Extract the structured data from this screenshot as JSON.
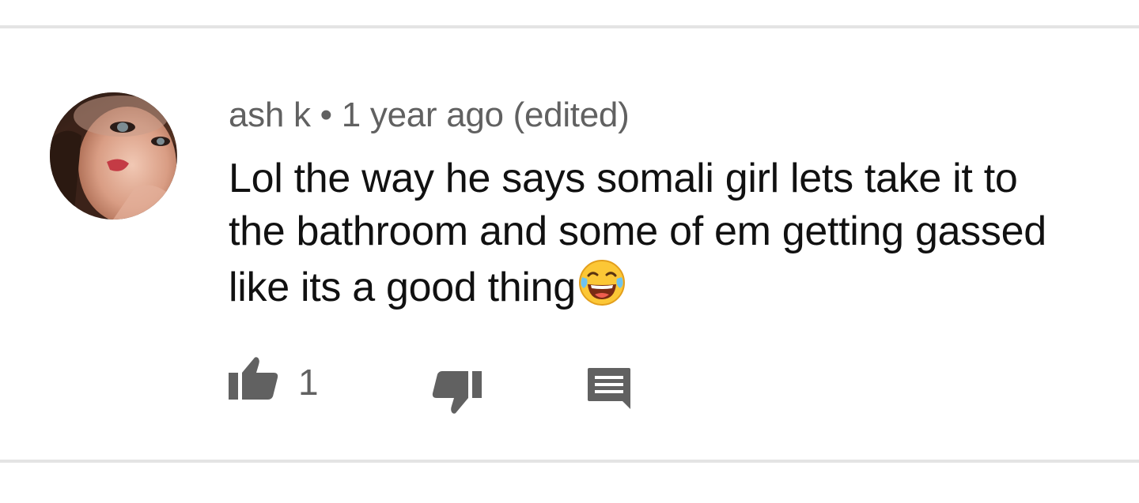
{
  "comment": {
    "author": "ash k",
    "separator": "•",
    "timestamp": "1 year ago (edited)",
    "text": "Lol the way he says somali girl lets take it to the bathroom and some of em getting gassed like its a good thing",
    "emoji": "face-with-tears-of-joy"
  },
  "actions": {
    "like_count": "1",
    "like_icon": "thumbs-up-icon",
    "dislike_icon": "thumbs-down-icon",
    "reply_icon": "comment-icon"
  },
  "colors": {
    "icon": "#616161",
    "divider": "#e4e4e4",
    "text": "#111111",
    "meta": "#616161"
  }
}
